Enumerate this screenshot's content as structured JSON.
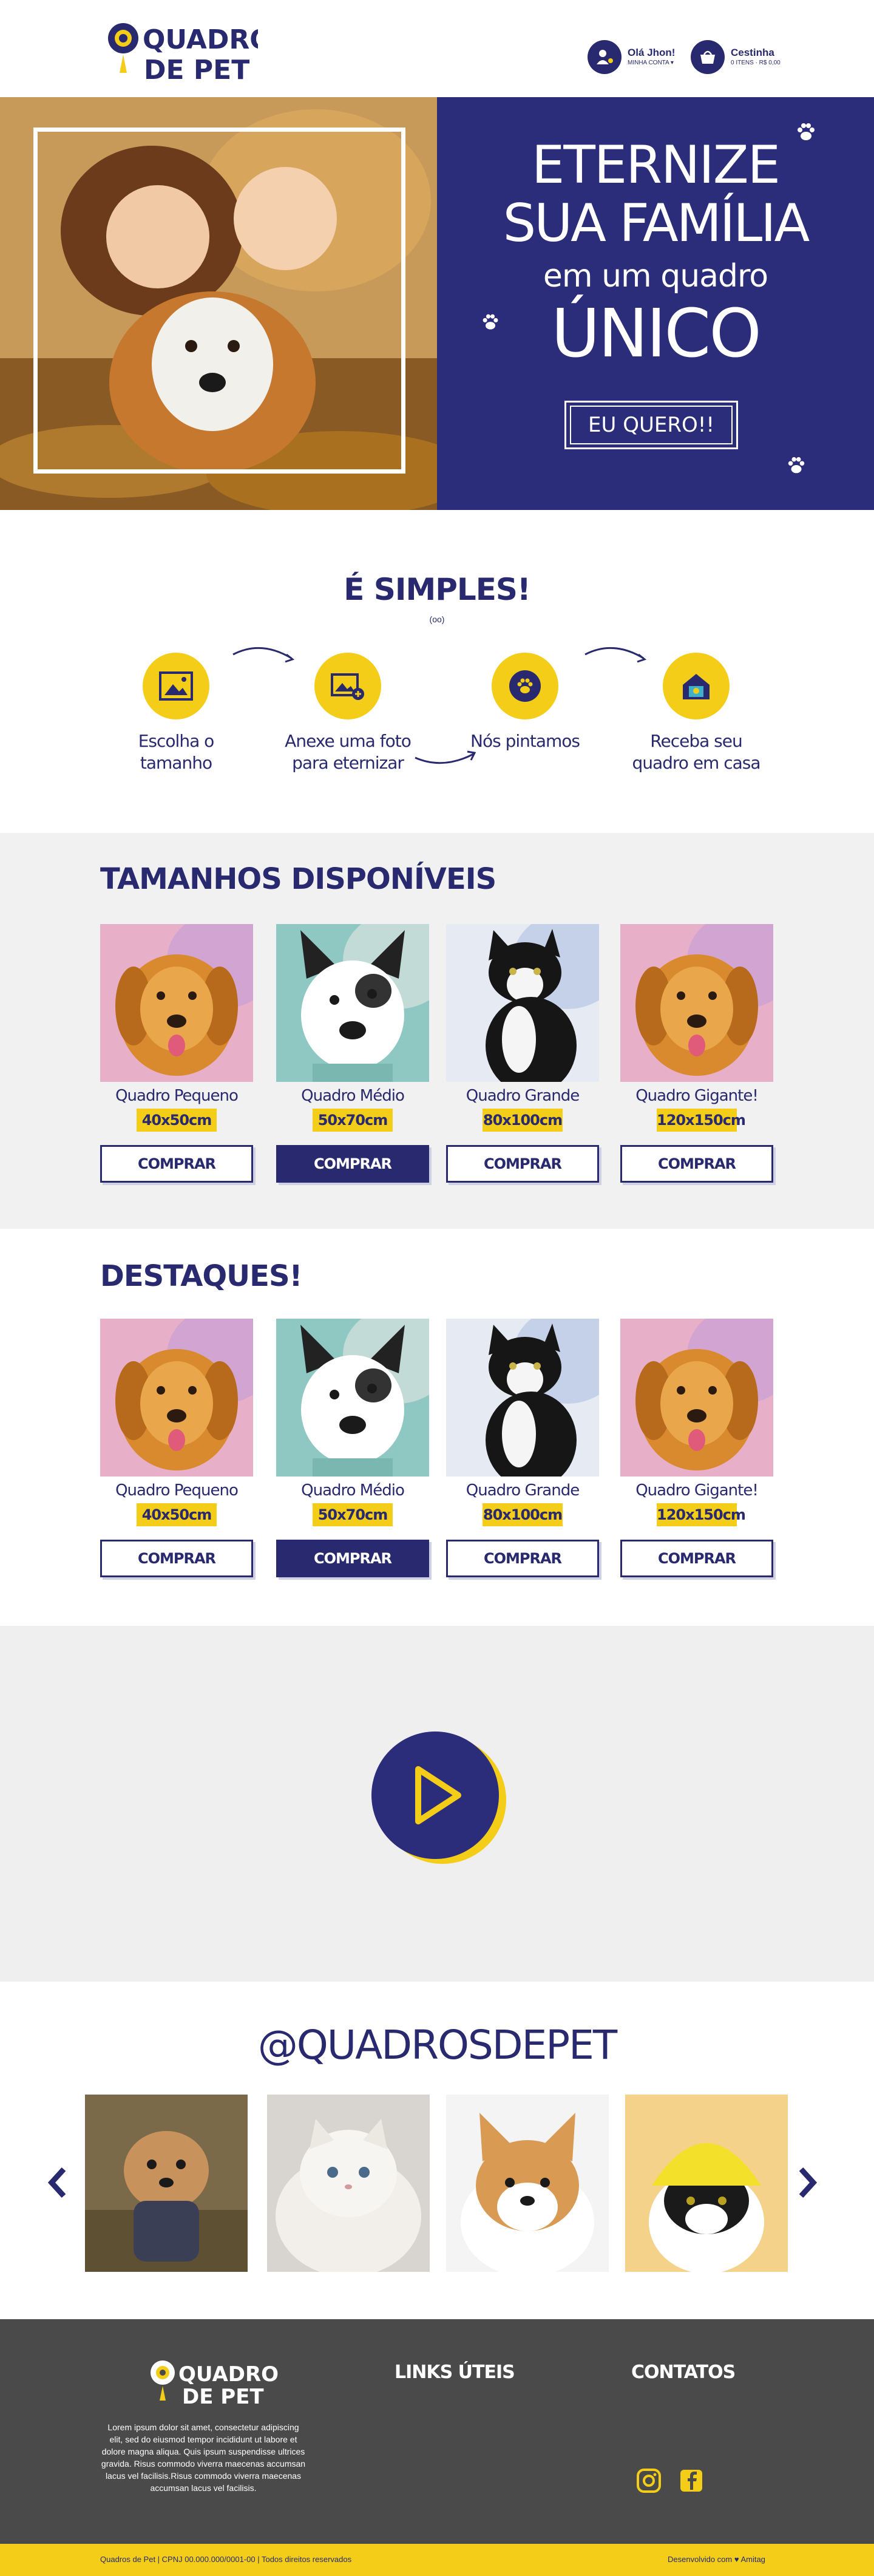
{
  "brand": {
    "logo_line1": "QUADROS",
    "logo_line2": "DE PET",
    "colors": {
      "navy": "#28296e",
      "yellow": "#f3cd17",
      "light_gray": "#f1f1f1",
      "footer_gray": "#4a4a4a"
    }
  },
  "header": {
    "account": {
      "title": "Olá Jhon!",
      "subtitle": "MINHA CONTA ▾",
      "icon": "user-paw-icon"
    },
    "cart": {
      "title": "Cestinha",
      "subtitle": "0 ITENS · R$ 0,00",
      "icon": "basket-icon"
    }
  },
  "hero": {
    "line1": "ETERNIZE",
    "line2": "SUA FAMÍLIA",
    "line3": "em um quadro",
    "line4": "ÚNICO",
    "cta": "EU QUERO!!"
  },
  "steps": {
    "title": "É SIMPLES!",
    "dots": "(oo)",
    "items": [
      {
        "label": "Escolha o tamanho",
        "icon": "frame-icon"
      },
      {
        "label": "Anexe uma foto para eternizar",
        "icon": "image-upload-icon"
      },
      {
        "label": "Nós pintamos",
        "icon": "paw-palette-icon"
      },
      {
        "label": "Receba seu quadro em casa",
        "icon": "house-frame-icon"
      }
    ]
  },
  "sizes": {
    "title": "TAMANHOS DISPONÍVEIS",
    "cards": [
      {
        "name": "Quadro Pequeno",
        "size": "40x50cm",
        "button": "COMPRAR"
      },
      {
        "name": "Quadro Médio",
        "size": "50x70cm",
        "button": "COMPRAR"
      },
      {
        "name": "Quadro Grande",
        "size": "80x100cm",
        "button": "COMPRAR"
      },
      {
        "name": "Quadro Gigante!",
        "size": "120x150cm",
        "button": "COMPRAR"
      }
    ]
  },
  "highlights": {
    "title": "DESTAQUES!",
    "cards": [
      {
        "name": "Quadro Pequeno",
        "size": "40x50cm",
        "button": "COMPRAR"
      },
      {
        "name": "Quadro Médio",
        "size": "50x70cm",
        "button": "COMPRAR"
      },
      {
        "name": "Quadro Grande",
        "size": "80x100cm",
        "button": "COMPRAR"
      },
      {
        "name": "Quadro Gigante!",
        "size": "120x150cm",
        "button": "COMPRAR"
      }
    ]
  },
  "instagram": {
    "handle": "@QUADROSDEPET"
  },
  "footer": {
    "about": "Lorem ipsum dolor sit amet, consectetur adipiscing elit, sed do eiusmod tempor incididunt ut labore et dolore magna aliqua. Quis ipsum suspendisse ultrices gravida. Risus commodo viverra maecenas accumsan lacus vel facilisis.Risus commodo viverra maecenas accumsan lacus vel facilisis.",
    "links_title": "LINKS ÚTEIS",
    "contacts_title": "CONTATOS",
    "copyright": "Quadros de Pet | CPNJ 00.000.000/0001-00 | Todos direitos reservados",
    "credit": "Desenvolvido com ♥ Amitag"
  }
}
